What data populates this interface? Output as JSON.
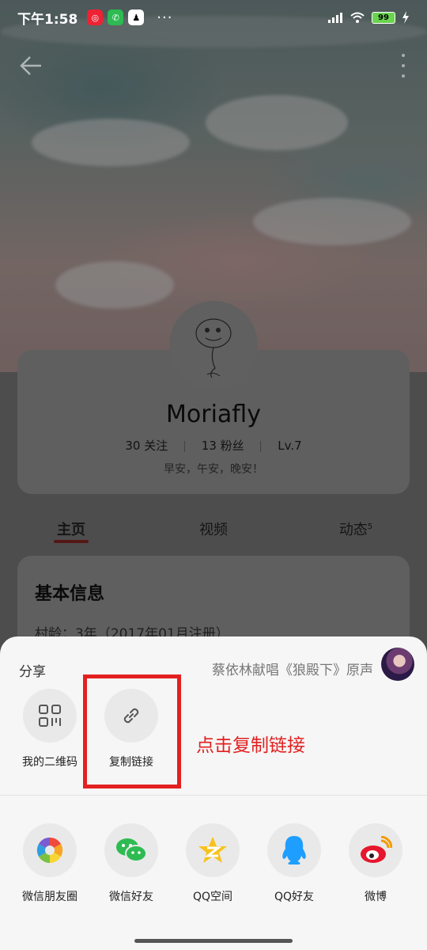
{
  "status_bar": {
    "time": "下午1:58",
    "apps": [
      "netease-music-icon",
      "wechat-icon",
      "qq-icon"
    ],
    "dots": "···",
    "battery": "99"
  },
  "profile": {
    "name": "Moriafly",
    "following_count": "30",
    "following_label": "关注",
    "fans_count": "13",
    "fans_label": "粉丝",
    "level": "Lv.7",
    "signature": "早安，午安，晚安！"
  },
  "tabs": [
    {
      "label": "主页"
    },
    {
      "label": "视频"
    },
    {
      "label": "动态",
      "badge": "5"
    }
  ],
  "info": {
    "title": "基本信息",
    "age_line": "村龄：3年（2017年01月注册）"
  },
  "share_sheet": {
    "title": "分享",
    "song": "蔡依林献唱《狼殿下》原声",
    "row1": [
      {
        "label": "我的二维码",
        "icon": "qr-code-icon"
      },
      {
        "label": "复制链接",
        "icon": "link-icon"
      }
    ],
    "hint": "点击复制链接",
    "row2": [
      {
        "label": "微信朋友圈",
        "icon": "wechat-moments-icon"
      },
      {
        "label": "微信好友",
        "icon": "wechat-icon"
      },
      {
        "label": "QQ空间",
        "icon": "qzone-icon"
      },
      {
        "label": "QQ好友",
        "icon": "qq-icon"
      },
      {
        "label": "微博",
        "icon": "weibo-icon"
      }
    ]
  },
  "colors": {
    "highlight": "#e32020",
    "sheet_bg": "#f6f6f6",
    "tab_underline": "#8a2525"
  }
}
